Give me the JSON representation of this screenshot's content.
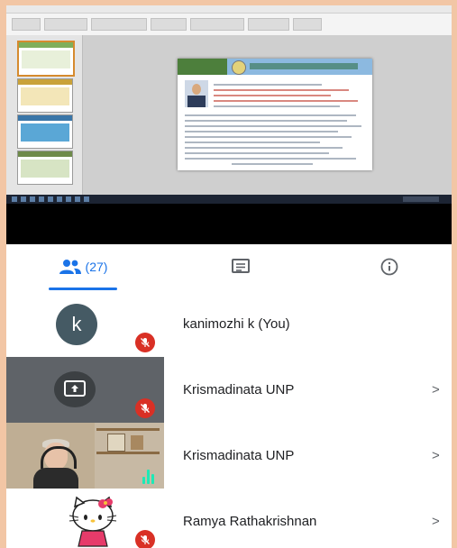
{
  "tabs": {
    "people": {
      "icon": "people-icon",
      "count": "(27)"
    },
    "chat": {
      "icon": "chat-icon"
    },
    "info": {
      "icon": "info-icon"
    }
  },
  "participants": [
    {
      "name": "kanimozhi k (You)",
      "avatar_letter": "k",
      "status": "muted",
      "has_chevron": false
    },
    {
      "name": "Krismadinata UNP",
      "status": "muted",
      "tile": "presenting",
      "has_chevron": true,
      "chevron": ">"
    },
    {
      "name": "Krismadinata UNP",
      "status": "speaking",
      "tile": "video",
      "has_chevron": true,
      "chevron": ">"
    },
    {
      "name": "Ramya Rathakrishnan",
      "status": "muted",
      "tile": "avatar-image",
      "has_chevron": true,
      "chevron": ">"
    }
  ],
  "colors": {
    "accent": "#1a73e8",
    "mute_badge": "#d93025",
    "avatar_bg": "#455a64",
    "speaking": "#1de9b6",
    "frame_border": "#f2c6a5"
  }
}
